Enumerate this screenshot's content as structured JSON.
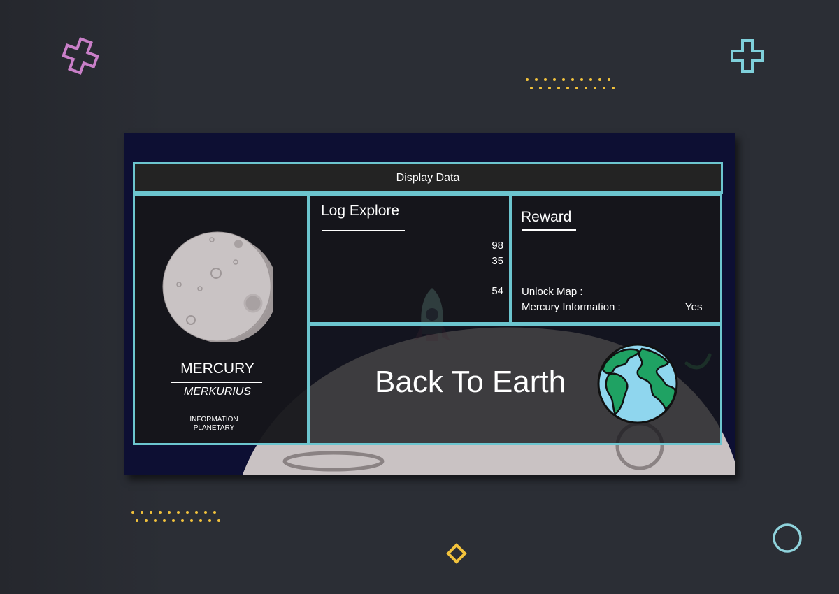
{
  "colors": {
    "background": "#2b2e35",
    "window_background": "#0d0f33",
    "panel_border": "#6cc5cf",
    "panel_fill": "#16161a",
    "plus_pink": "#c97fc8",
    "plus_cyan": "#7fd0db",
    "dots_yellow": "#f2c23c",
    "diamond_yellow": "#f2c23c",
    "circle_cyan": "#8fd3dc"
  },
  "header": {
    "title": "Display Data"
  },
  "planet": {
    "name": "MERCURY",
    "alias": "MERKURIUS",
    "info_line1": "INFORMATION",
    "info_line2": "PLANETARY",
    "icon": "mercury-planet-icon"
  },
  "log_explore": {
    "title": "Log Explore",
    "values": [
      "98",
      "35",
      "54"
    ]
  },
  "reward": {
    "title": "Reward",
    "unlock_map_label": "Unlock Map :",
    "mercury_info_label": "Mercury Information :",
    "mercury_info_value": "Yes"
  },
  "back": {
    "label": "Back To Earth",
    "icon": "earth-icon"
  },
  "decorations": {
    "icons": [
      "plus-outline-icon",
      "plus-outline-icon",
      "diamond-outline-icon",
      "circle-outline-icon",
      "rocket-icon"
    ]
  }
}
